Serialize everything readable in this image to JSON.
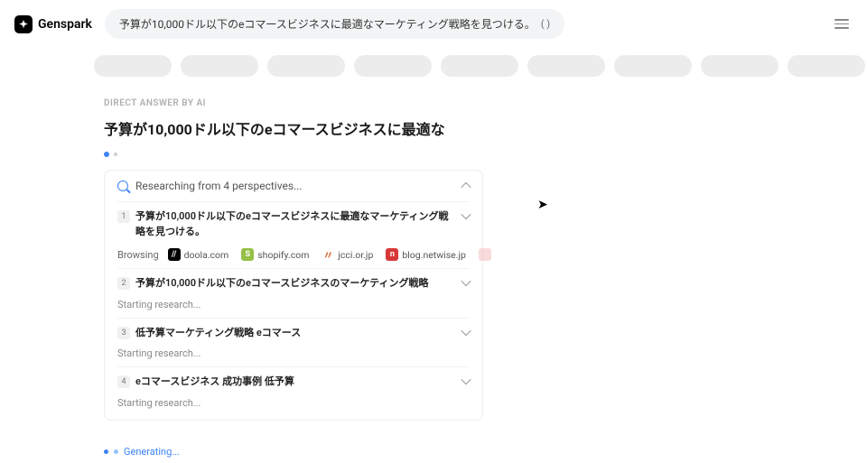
{
  "header": {
    "logo_text": "Genspark",
    "query": "予算が10,000ドル以下のeコマースビジネスに最適なマーケティング戦略を見つける。",
    "query_suffix": "( )"
  },
  "answer": {
    "label": "DIRECT ANSWER BY AI",
    "title": "予算が10,000ドル以下のeコマースビジネスに最適な"
  },
  "research": {
    "header": "Researching from 4 perspectives...",
    "perspectives": [
      {
        "num": "1",
        "title": "予算が10,000ドル以下のeコマースビジネスに最適なマーケティング戦略を見つける。",
        "browsing_label": "Browsing",
        "status": ""
      },
      {
        "num": "2",
        "title": "予算が10,000ドル以下のeコマースビジネスのマーケティング戦略",
        "status": "Starting research..."
      },
      {
        "num": "3",
        "title": "低予算マーケティング戦略 eコマース",
        "status": "Starting research..."
      },
      {
        "num": "4",
        "title": "eコマースビジネス 成功事例 低予算",
        "status": "Starting research..."
      }
    ],
    "sources": [
      {
        "icon_letter": "//",
        "name": "doola.com"
      },
      {
        "icon_letter": "S",
        "name": "shopify.com"
      },
      {
        "icon_letter": "〃",
        "name": "jcci.or.jp"
      },
      {
        "icon_letter": "n",
        "name": "blog.netwise.jp"
      }
    ]
  },
  "generating": "Generating..."
}
